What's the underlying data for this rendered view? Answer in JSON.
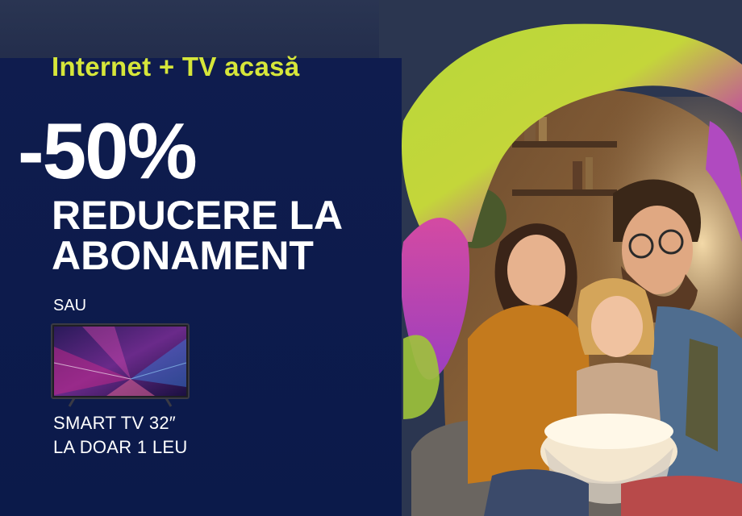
{
  "banner": {
    "headline": "Internet + TV acasă",
    "discount": "-50%",
    "offer_line_1": "REDUCERE LA",
    "offer_line_2": "ABONAMENT",
    "or_label": "SAU",
    "tv_offer_line_1": "SMART TV 32″",
    "tv_offer_line_2": "LA DOAR 1 LEU"
  },
  "colors": {
    "panel_background": "#0b1a4a",
    "headline_accent": "#d6e63a",
    "text_primary": "#ffffff",
    "swirl_green": "#b8d83a",
    "swirl_magenta": "#c13fa8",
    "swirl_violet": "#8e3fbd"
  },
  "images": {
    "tv_image": "smart-tv-image",
    "family_photo": "family-watching-tv-photo"
  }
}
